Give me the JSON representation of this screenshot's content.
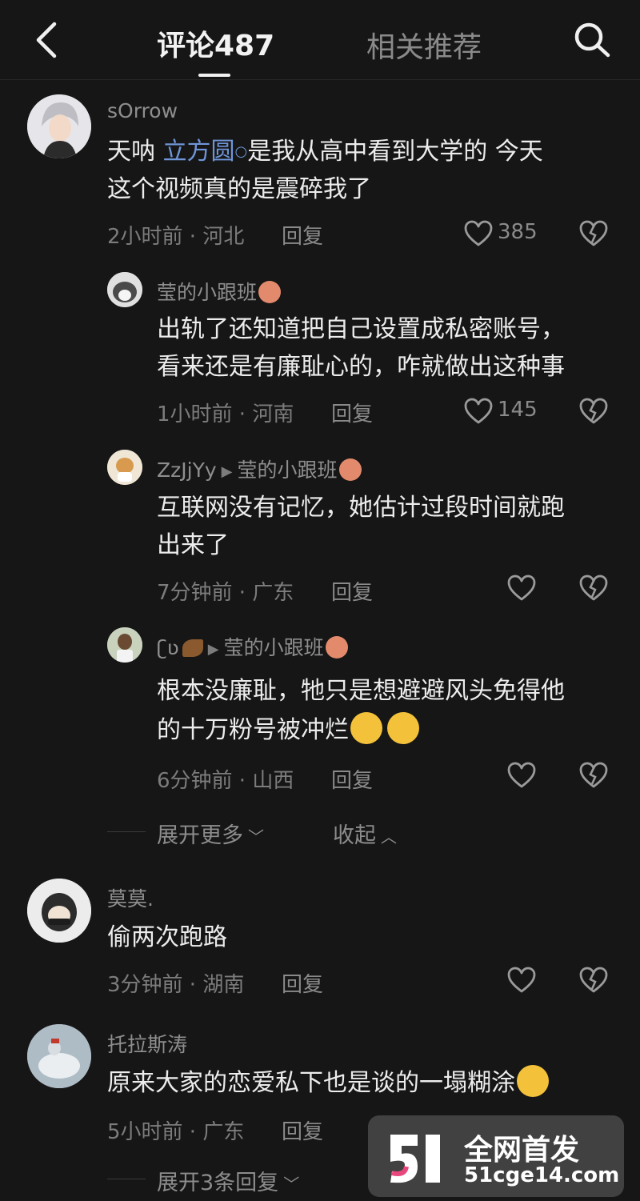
{
  "header": {
    "tab_comments": "评论487",
    "tab_related": "相关推荐"
  },
  "comments": [
    {
      "user": "sOrrow",
      "text_pre": "天呐 ",
      "mention": "立方圆",
      "text_post": "是我从高中看到大学的 今天",
      "text_line2": "这个视频真的是震碎我了",
      "meta": "2小时前 · 河北",
      "reply": "回复",
      "likes": "385"
    },
    {
      "user": "莹的小跟班",
      "text_line1": "出轨了还知道把自己设置成私密账号，",
      "text_line2": "看来还是有廉耻心的，咋就做出这种事",
      "meta": "1小时前 · 河南",
      "reply": "回复",
      "likes": "145"
    },
    {
      "user": "ZzJjYy",
      "reply_to": "莹的小跟班",
      "text_line1": "互联网没有记忆，她估计过段时间就跑",
      "text_line2": "出来了",
      "meta": "7分钟前 · 广东",
      "reply": "回复"
    },
    {
      "user": "ʗʋ",
      "reply_to": "莹的小跟班",
      "text_line1": "根本没廉耻，牠只是想避避风头免得他",
      "text_line2": "的十万粉号被冲烂",
      "meta": "6分钟前 · 山西",
      "reply": "回复"
    },
    {
      "user": "莫莫.",
      "text_line1": "偷两次跑路",
      "meta": "3分钟前 · 湖南",
      "reply": "回复"
    },
    {
      "user": "托拉斯涛",
      "text_line1": "原来大家的恋爱私下也是谈的一塌糊涂",
      "meta": "5小时前 · 广东",
      "reply": "回复"
    }
  ],
  "thread_controls": {
    "expand_more": "展开更多",
    "collapse": "收起"
  },
  "expand_replies": "展开3条回复",
  "watermark": {
    "line1": "全网首发",
    "line2": "51cge14.com"
  },
  "colors": {
    "background": "#161616",
    "mention": "#6f95d8"
  }
}
